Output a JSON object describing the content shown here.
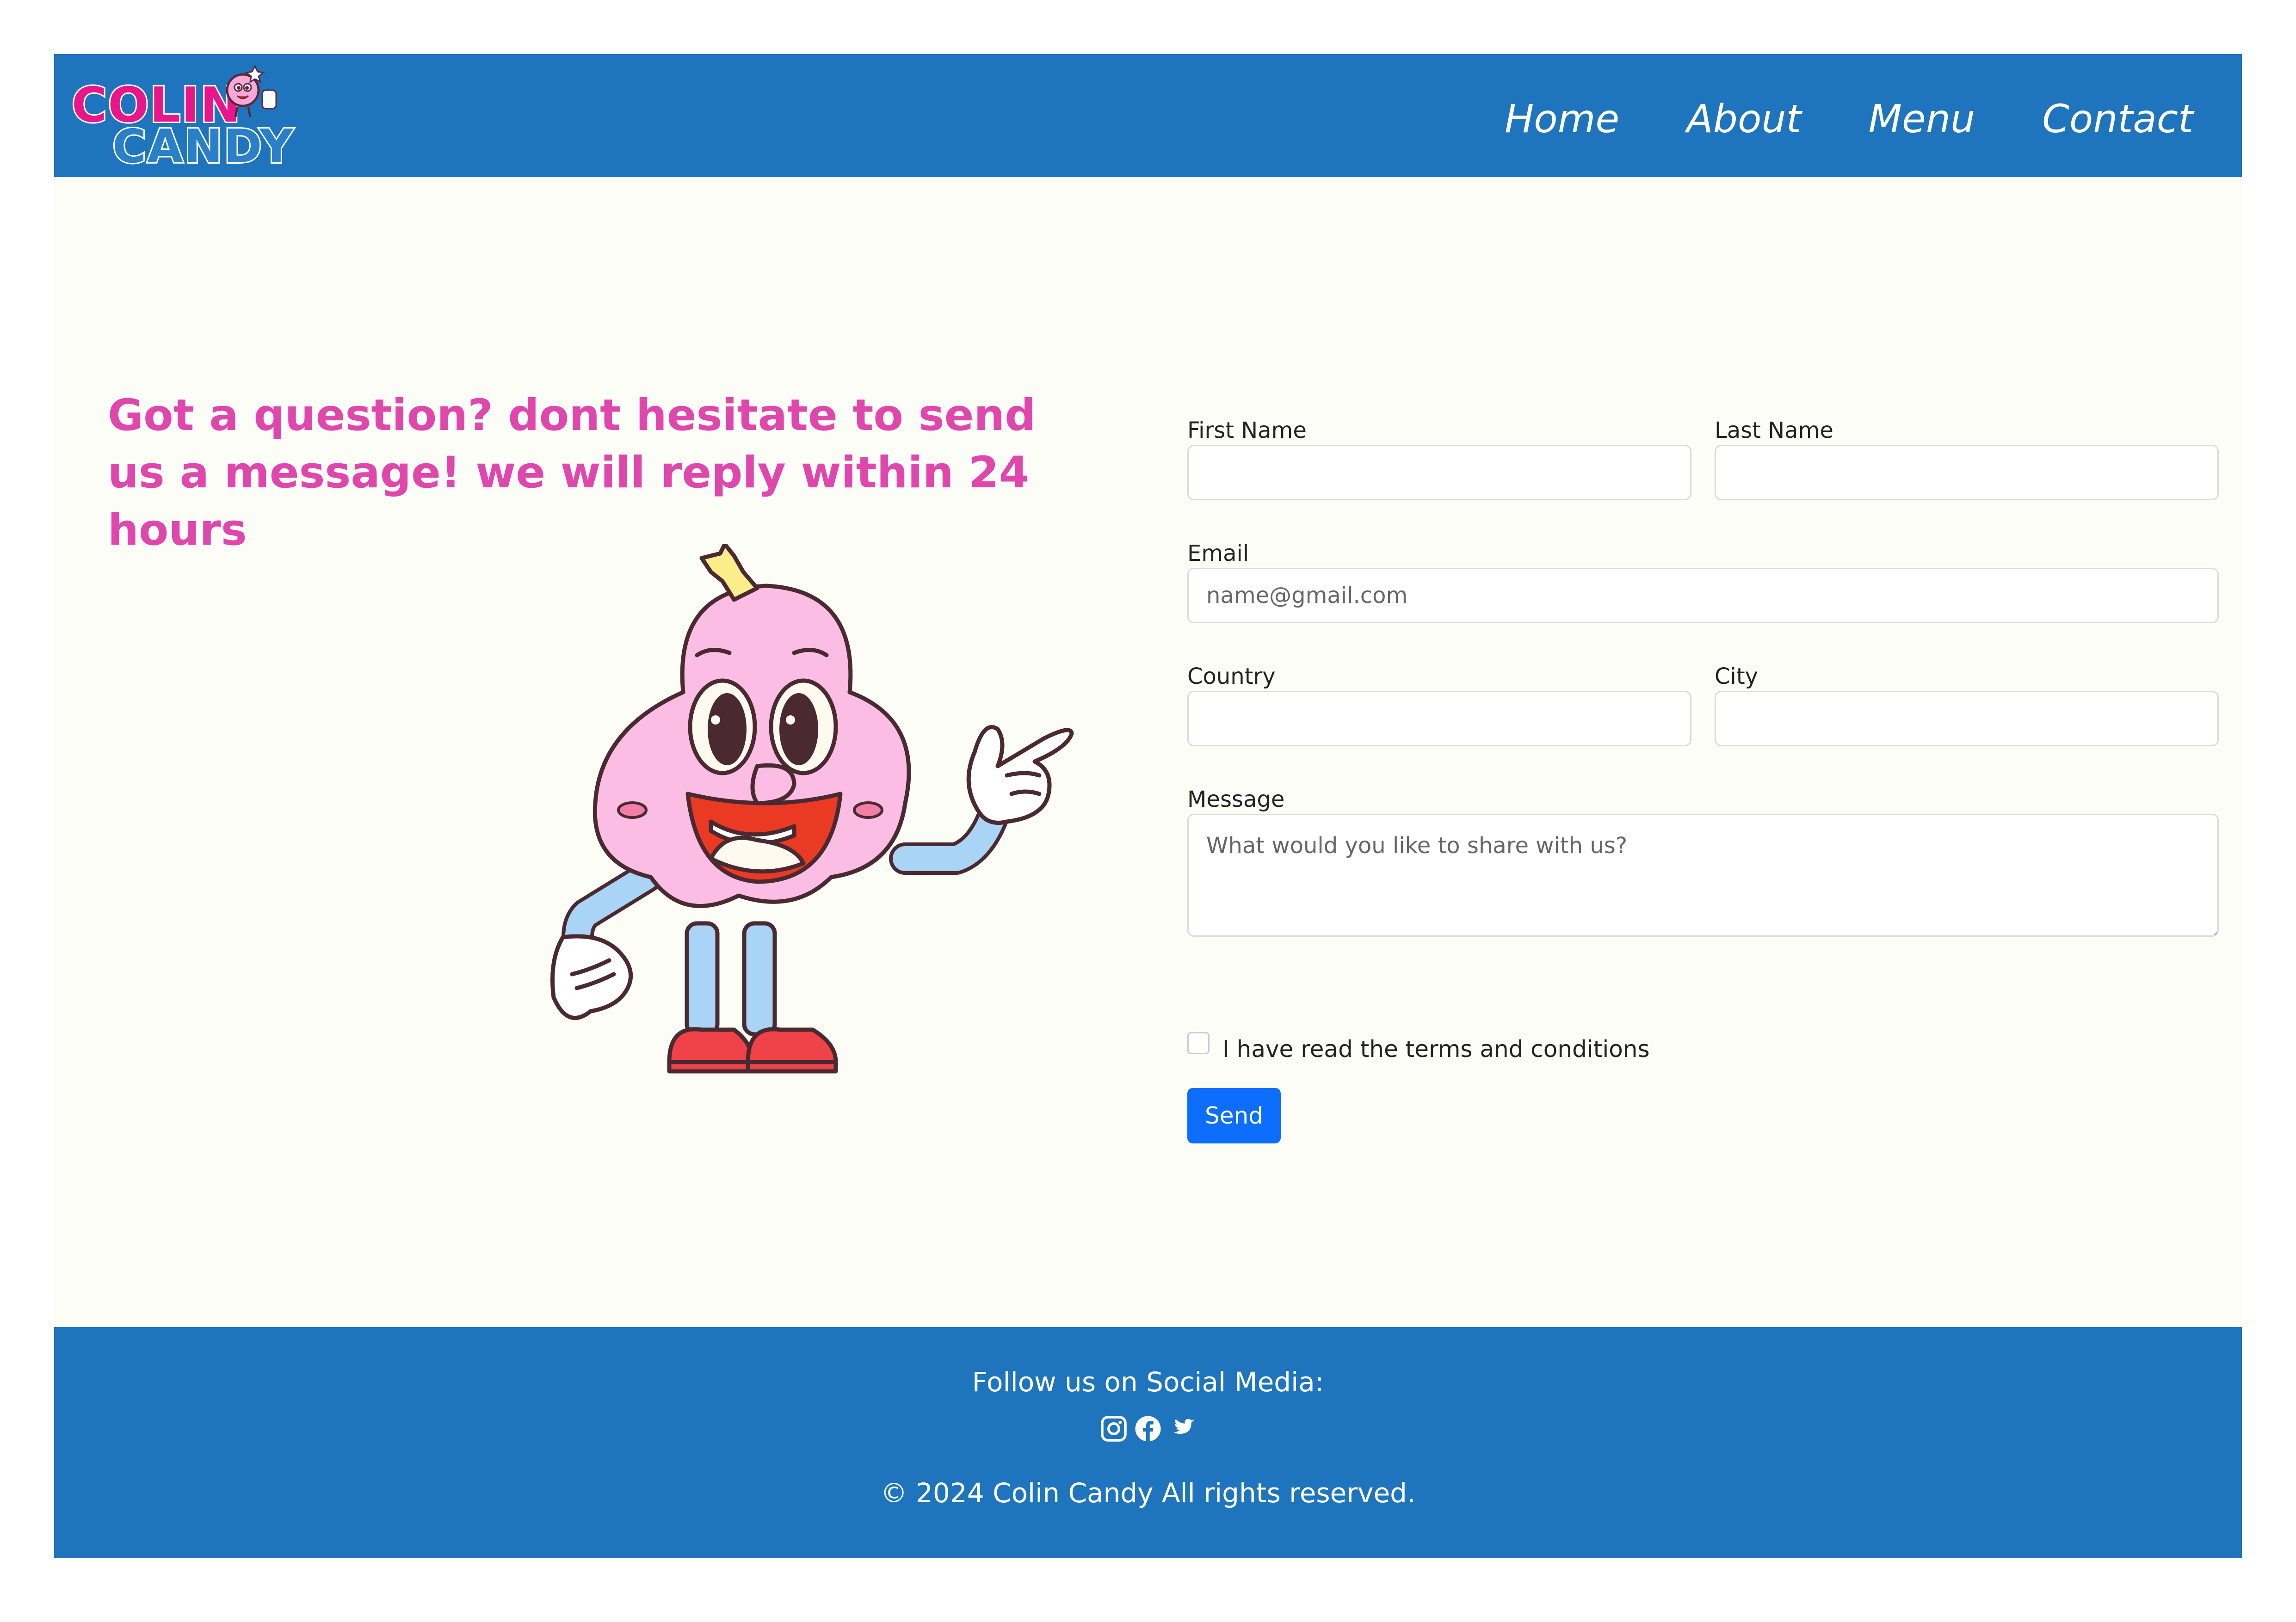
{
  "brand": {
    "logo_line1": "COLIN",
    "logo_line2": "CANDY",
    "primary_color": "#1f75bd",
    "accent_color": "#e047ad"
  },
  "nav": {
    "items": [
      {
        "label": "Home"
      },
      {
        "label": "About"
      },
      {
        "label": "Menu"
      },
      {
        "label": "Contact"
      }
    ]
  },
  "main": {
    "headline": "Got a question? dont hesitate to send us a message! we will reply within 24 hours"
  },
  "form": {
    "first_name_label": "First Name",
    "first_name_value": "",
    "last_name_label": "Last Name",
    "last_name_value": "",
    "email_label": "Email",
    "email_placeholder": "name@gmail.com",
    "email_value": "",
    "country_label": "Country",
    "country_value": "",
    "city_label": "City",
    "city_value": "",
    "message_label": "Message",
    "message_placeholder": "What would you like to share with us?",
    "message_value": "",
    "terms_label": "I have read the terms and conditions",
    "terms_checked": false,
    "send_label": "Send",
    "send_color": "#0d6efd"
  },
  "footer": {
    "follow_text": "Follow us on Social Media:",
    "social_icons": [
      "instagram-icon",
      "facebook-icon",
      "twitter-icon"
    ],
    "copyright": "© 2024 Colin Candy All rights reserved."
  }
}
